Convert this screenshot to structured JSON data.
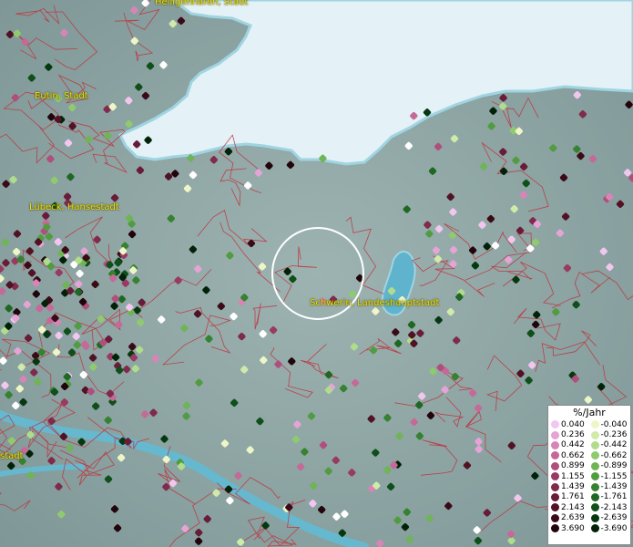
{
  "legend": {
    "title": "%/Jahr",
    "positive": [
      {
        "label": "0.040",
        "color": "#f2c6ef"
      },
      {
        "label": "0.236",
        "color": "#e6a3d6"
      },
      {
        "label": "0.442",
        "color": "#d984b7"
      },
      {
        "label": "0.662",
        "color": "#c56a98"
      },
      {
        "label": "0.899",
        "color": "#b04f7c"
      },
      {
        "label": "1.155",
        "color": "#983a62"
      },
      {
        "label": "1.439",
        "color": "#802a4c"
      },
      {
        "label": "1.761",
        "color": "#681c38"
      },
      {
        "label": "2.143",
        "color": "#511225"
      },
      {
        "label": "2.639",
        "color": "#3a0a17"
      },
      {
        "label": "3.690",
        "color": "#22040b"
      }
    ],
    "negative": [
      {
        "label": "-0.040",
        "color": "#eef6c7"
      },
      {
        "label": "-0.236",
        "color": "#cfeaa9"
      },
      {
        "label": "-0.442",
        "color": "#b0dc8c"
      },
      {
        "label": "-0.662",
        "color": "#8fca6f"
      },
      {
        "label": "-0.899",
        "color": "#6fb456"
      },
      {
        "label": "-1.155",
        "color": "#519c41"
      },
      {
        "label": "-1.439",
        "color": "#368230"
      },
      {
        "label": "-1.761",
        "color": "#1f6824"
      },
      {
        "label": "-2.143",
        "color": "#0f4f19"
      },
      {
        "label": "-2.639",
        "color": "#063810"
      },
      {
        "label": "-3.690",
        "color": "#022208"
      }
    ]
  },
  "cities": [
    {
      "name": "Heiligenhafen, Stadt"
    },
    {
      "name": "Eutin, Stadt"
    },
    {
      "name": "Lübeck, Hansestadt"
    },
    {
      "name": "Schwerin, Landeshauptstadt"
    },
    {
      "name": "stadt"
    }
  ],
  "colors": {
    "land": "#8aa2a1",
    "sea": "#dfeef4",
    "boundary": "#c0303c",
    "highlight_circle": "#ffffff"
  }
}
